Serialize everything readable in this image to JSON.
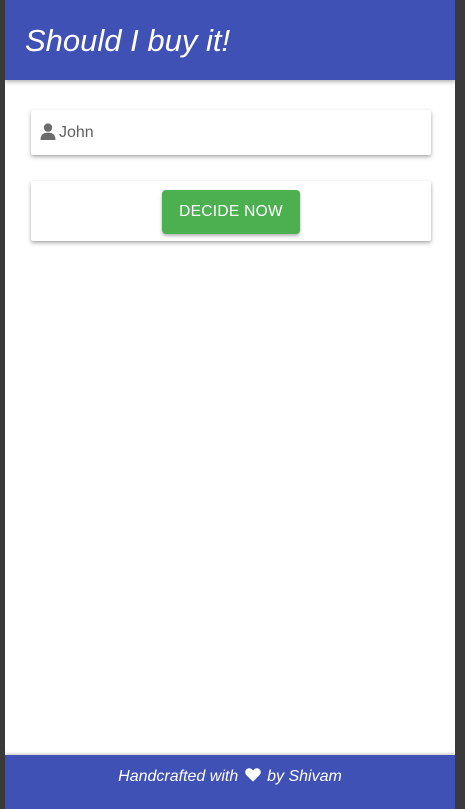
{
  "header": {
    "title": "Should I buy it!"
  },
  "form": {
    "name_value": "John",
    "icon": "user-icon"
  },
  "actions": {
    "decide_label": "DECIDE NOW"
  },
  "footer": {
    "prefix": "Handcrafted with",
    "icon": "heart-icon",
    "suffix": "by Shivam"
  },
  "colors": {
    "primary": "#3f51b5",
    "accent": "#4caf50",
    "background": "#ffffff"
  }
}
